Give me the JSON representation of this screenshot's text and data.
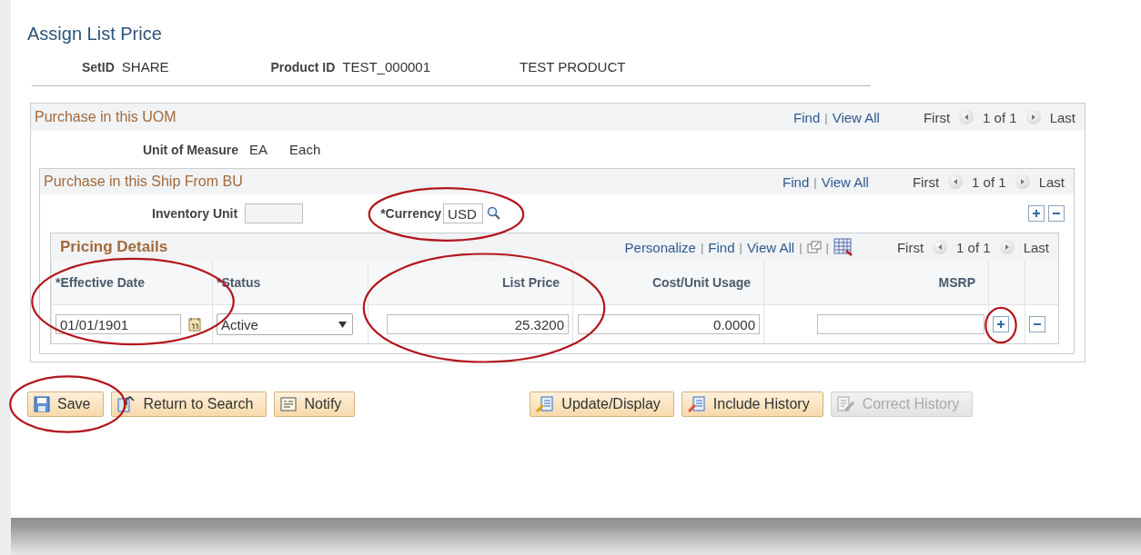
{
  "title": "Assign List Price",
  "header": {
    "setid_label": "SetID",
    "setid_value": "SHARE",
    "product_label": "Product ID",
    "product_value": "TEST_000001",
    "product_desc": "TEST PRODUCT"
  },
  "uom": {
    "title": "Purchase in this UOM",
    "tools": [
      {
        "kind": "link",
        "text": "Find"
      },
      {
        "kind": "sep",
        "text": "|"
      },
      {
        "kind": "link",
        "text": "View All"
      }
    ],
    "nav": {
      "first": "First",
      "count": "1 of 1",
      "last": "Last"
    },
    "unit_label": "Unit of Measure",
    "unit_code": "EA",
    "unit_desc": "Each",
    "ship": {
      "title": "Purchase in this Ship From BU",
      "tools": [
        {
          "kind": "link",
          "text": "Find"
        },
        {
          "kind": "sep",
          "text": "|"
        },
        {
          "kind": "link",
          "text": "View All"
        }
      ],
      "nav": {
        "first": "First",
        "count": "1 of 1",
        "last": "Last"
      },
      "inventory_label": "Inventory Unit",
      "currency_label": "*Currency",
      "currency_value": "USD",
      "currency_circled": true,
      "pricing": {
        "title": "Pricing Details",
        "tools": [
          {
            "kind": "link",
            "text": "Personalize"
          },
          {
            "kind": "sep",
            "text": "|"
          },
          {
            "kind": "link",
            "text": "Find"
          },
          {
            "kind": "sep",
            "text": "|"
          },
          {
            "kind": "link",
            "text": "View All"
          },
          {
            "kind": "sep",
            "text": "|"
          },
          {
            "kind": "zoom"
          },
          {
            "kind": "sep",
            "text": "|"
          },
          {
            "kind": "download"
          }
        ],
        "nav": {
          "first": "First",
          "count": "1 of 1",
          "last": "Last"
        },
        "columns": [
          {
            "label": "*Effective Date",
            "kind": "date",
            "circled": true
          },
          {
            "label": "*Status",
            "kind": "select",
            "circled": false
          },
          {
            "label": "List Price",
            "kind": "number",
            "circled": true
          },
          {
            "label": "Cost/Unit Usage",
            "kind": "number",
            "circled": false
          },
          {
            "label": "MSRP",
            "kind": "number",
            "circled": false
          }
        ],
        "rows": [
          {
            "values": [
              "01/01/1901",
              "Active",
              "25.3200",
              "0.0000"
            ],
            "add_circled": true
          }
        ]
      }
    }
  },
  "buttons": [
    {
      "label": "Save",
      "disabled": false,
      "circled": true
    },
    {
      "label": "Return to Search",
      "disabled": false,
      "circled": false
    },
    {
      "label": "Notify",
      "disabled": false,
      "circled": false
    },
    {
      "label": "Update/Display",
      "disabled": false,
      "circled": false
    },
    {
      "label": "Include History",
      "disabled": false,
      "circled": false
    },
    {
      "label": "Correct History",
      "disabled": true,
      "circled": false
    }
  ]
}
